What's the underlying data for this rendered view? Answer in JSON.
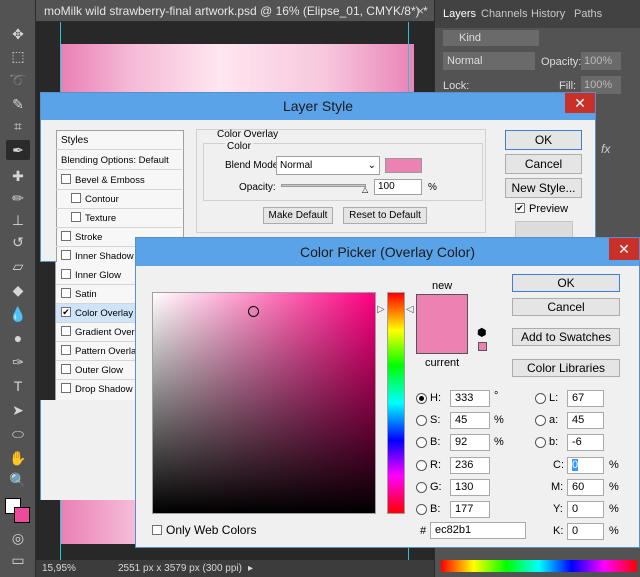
{
  "document": {
    "tab_title": "moMilk wild strawberry-final artwork.psd @ 16% (Elipse_01, CMYK/8*) *",
    "zoom": "15,95%",
    "doc_info": "2551 px x 3579 px (300 ppi)"
  },
  "layers_panel": {
    "tabs": [
      "Layers",
      "Channels",
      "History",
      "Paths"
    ],
    "kind_label": "Kind",
    "blend_mode": "Normal",
    "opacity_label": "Opacity:",
    "opacity_value": "100%",
    "lock_label": "Lock:",
    "fill_label": "Fill:",
    "fill_value": "100%"
  },
  "layer_style": {
    "title": "Layer Style",
    "styles_header": "Styles",
    "blending_options": "Blending Options: Default",
    "style_items": [
      {
        "label": "Bevel & Emboss",
        "checked": false
      },
      {
        "label": "Contour",
        "checked": false
      },
      {
        "label": "Texture",
        "checked": false
      },
      {
        "label": "Stroke",
        "checked": false
      },
      {
        "label": "Inner Shadow",
        "checked": false
      },
      {
        "label": "Inner Glow",
        "checked": false
      },
      {
        "label": "Satin",
        "checked": false
      },
      {
        "label": "Color Overlay",
        "checked": true
      },
      {
        "label": "Gradient Overlay",
        "checked": false
      },
      {
        "label": "Pattern Overlay",
        "checked": false
      },
      {
        "label": "Outer Glow",
        "checked": false
      },
      {
        "label": "Drop Shadow",
        "checked": false
      }
    ],
    "section_title": "Color Overlay",
    "group_title": "Color",
    "blend_mode_label": "Blend Mode:",
    "blend_mode_value": "Normal",
    "opacity_label": "Opacity:",
    "opacity_value": "100",
    "opacity_unit": "%",
    "make_default": "Make Default",
    "reset_default": "Reset to Default",
    "ok": "OK",
    "cancel": "Cancel",
    "new_style": "New Style...",
    "preview_label": "Preview",
    "overlay_color": "#ec82b1"
  },
  "color_picker": {
    "title": "Color Picker (Overlay Color)",
    "new_label": "new",
    "current_label": "current",
    "ok": "OK",
    "cancel": "Cancel",
    "add_swatches": "Add to Swatches",
    "color_libraries": "Color Libraries",
    "only_web_colors": "Only Web Colors",
    "hex_label": "#",
    "hex_value": "ec82b1",
    "hsb": [
      {
        "label": "H:",
        "value": "333",
        "unit": "°",
        "selected": true
      },
      {
        "label": "S:",
        "value": "45",
        "unit": "%",
        "selected": false
      },
      {
        "label": "B:",
        "value": "92",
        "unit": "%",
        "selected": false
      }
    ],
    "rgb": [
      {
        "label": "R:",
        "value": "236"
      },
      {
        "label": "G:",
        "value": "130"
      },
      {
        "label": "B:",
        "value": "177"
      }
    ],
    "lab": [
      {
        "label": "L:",
        "value": "67"
      },
      {
        "label": "a:",
        "value": "45"
      },
      {
        "label": "b:",
        "value": "-6"
      }
    ],
    "cmyk": [
      {
        "label": "C:",
        "value": "0",
        "unit": "%"
      },
      {
        "label": "M:",
        "value": "60",
        "unit": "%"
      },
      {
        "label": "Y:",
        "value": "0",
        "unit": "%"
      },
      {
        "label": "K:",
        "value": "0",
        "unit": "%"
      }
    ],
    "new_color": "#ec82b1",
    "current_color": "#ec82b1"
  }
}
